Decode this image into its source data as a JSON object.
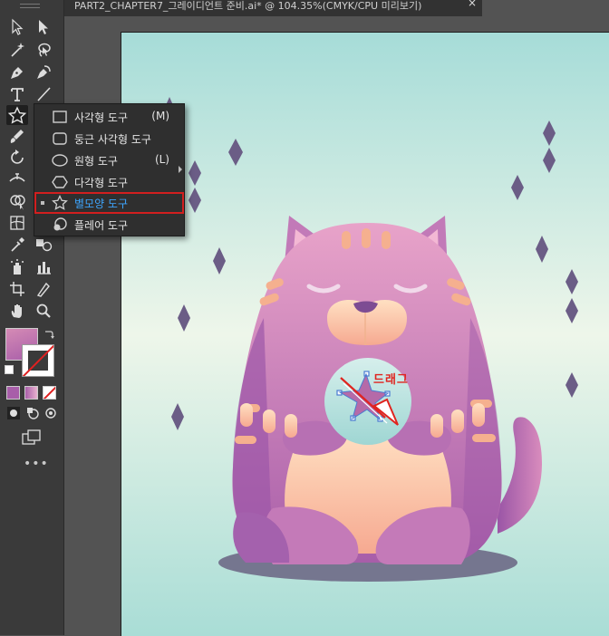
{
  "window": {
    "doc_tab_title": "PART2_CHAPTER7_그레이디언트 준비.ai* @ 104.35%(CMYK/CPU 미리보기)",
    "close_glyph": "×"
  },
  "toolbar": {
    "tools": [
      "selection-tool",
      "direct-selection-tool",
      "magic-wand-tool",
      "lasso-tool",
      "pen-tool",
      "curvature-tool",
      "type-tool",
      "line-tool",
      "star-tool",
      "paintbrush-tool",
      "pencil-tool",
      "rotate-tool",
      "scale-tool",
      "width-tool",
      "free-transform-tool",
      "shape-builder-tool",
      "perspective-grid-tool",
      "mesh-tool",
      "gradient-tool",
      "eyedropper-tool",
      "blend-tool",
      "symbol-sprayer-tool",
      "column-graph-tool",
      "artboard-tool",
      "slice-tool",
      "hand-tool",
      "zoom-tool"
    ],
    "more_label": "•••",
    "fill_color": "#b565a0",
    "fill_color_2": "#d58bb5"
  },
  "flyout_menu": {
    "items": [
      {
        "icon": "rectangle-icon",
        "label": "사각형 도구",
        "shortcut": "(M)",
        "selected": false
      },
      {
        "icon": "rounded-rectangle-icon",
        "label": "둥근 사각형 도구",
        "shortcut": "",
        "selected": false
      },
      {
        "icon": "ellipse-icon",
        "label": "원형 도구",
        "shortcut": "(L)",
        "selected": false
      },
      {
        "icon": "polygon-icon",
        "label": "다각형 도구",
        "shortcut": "",
        "selected": false
      },
      {
        "icon": "star-icon",
        "label": "별모양 도구",
        "shortcut": "",
        "selected": true
      },
      {
        "icon": "flare-icon",
        "label": "플레어 도구",
        "shortcut": "",
        "selected": false
      }
    ]
  },
  "canvas": {
    "annotation_text": "드래그",
    "colors": {
      "bg_top": "#a6dcd8",
      "bg_mid": "#e5f3ec",
      "bg_bottom": "#a9ddd6",
      "cat_purple": "#a85ea9",
      "cat_pink": "#e18fbc",
      "cat_peach": "#ffd3ad",
      "diamond": "#6b5d86",
      "shadow": "#75768f",
      "annotation_red": "#e0241f",
      "selection_blue": "#4a7bd1"
    }
  }
}
